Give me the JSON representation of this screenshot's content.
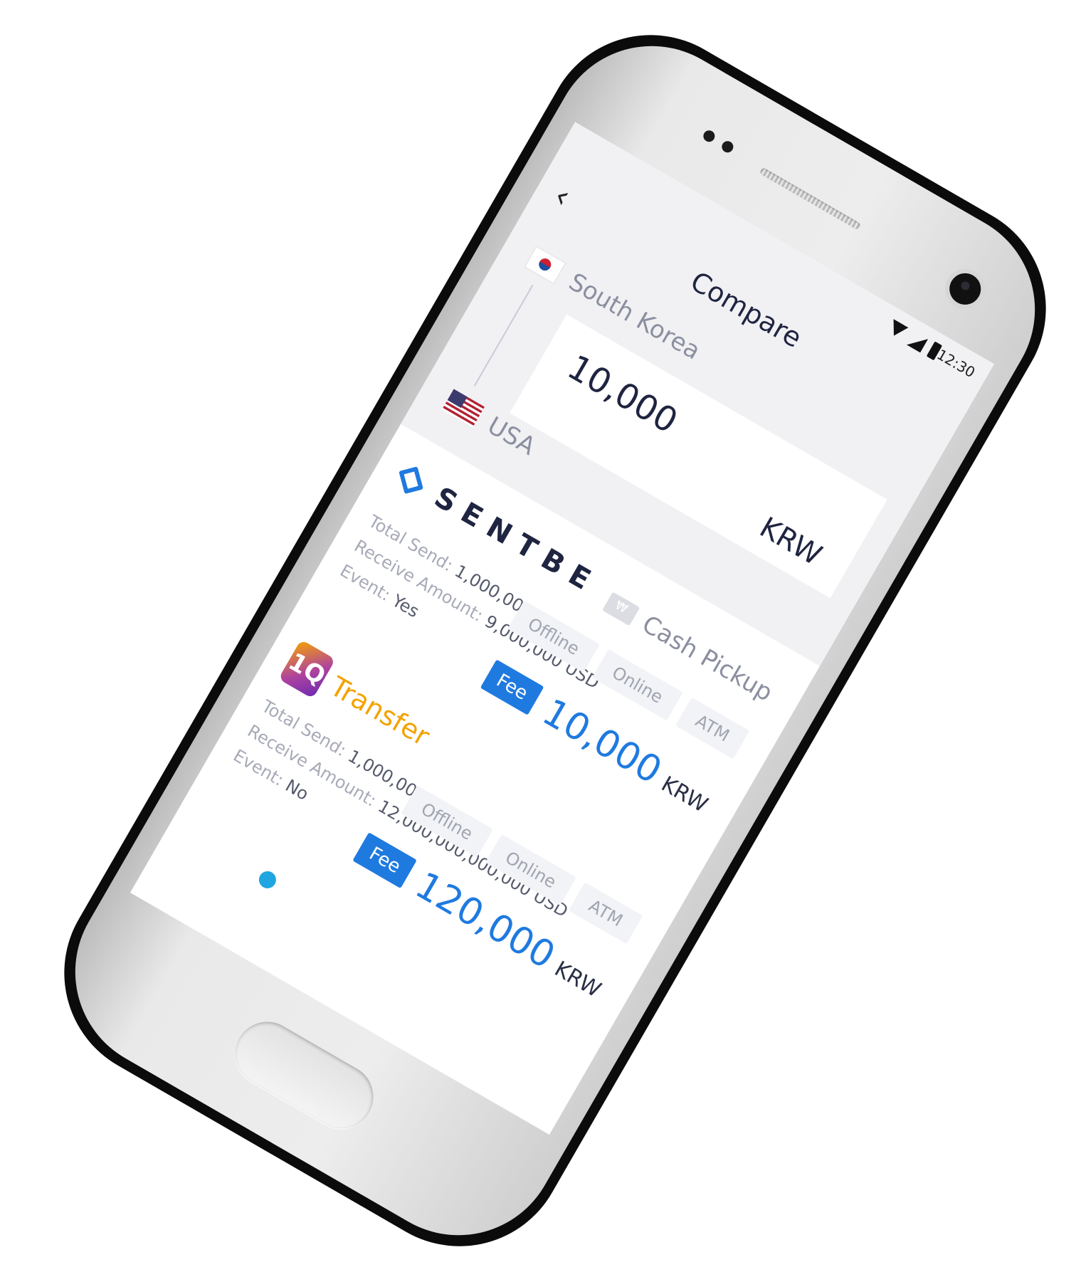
{
  "status_bar": {
    "time": "12:30"
  },
  "header": {
    "title": "Compare",
    "from_country": "South Korea",
    "to_country": "USA",
    "amount": "10,000",
    "currency": "KRW"
  },
  "providers": [
    {
      "name": "SENTBE",
      "method": "Cash Pickup",
      "total_send_label": "Total Send:",
      "total_send": "1,000,000 KRW",
      "receive_amount_label": "Receive Amount:",
      "receive_amount": "9,000,000 USD",
      "event_label": "Event:",
      "event": "Yes",
      "channels": [
        "Offline",
        "Online",
        "ATM"
      ],
      "fee_label": "Fee",
      "fee": "10,000",
      "fee_currency": "KRW"
    },
    {
      "logo_mark": "1Q",
      "name": "Transfer",
      "total_send_label": "Total Send:",
      "total_send": "1,000,000 KRW",
      "receive_amount_label": "Receive Amount:",
      "receive_amount": "12,000,000,000,000 USD",
      "event_label": "Event:",
      "event": "No",
      "channels": [
        "Offline",
        "Online",
        "ATM"
      ],
      "fee_label": "Fee",
      "fee": "120,000",
      "fee_currency": "KRW"
    }
  ],
  "colors": {
    "accent": "#1f7ae0",
    "title_text": "#1f2440",
    "muted_text": "#8b8fa0",
    "transfer_orange": "#f3a200"
  },
  "icons": [
    "back-icon",
    "signal-icon",
    "wifi-icon",
    "battery-icon",
    "korea-flag-icon",
    "usa-flag-icon",
    "cash-pickup-icon",
    "sentbe-logo-icon",
    "1q-logo-icon"
  ]
}
